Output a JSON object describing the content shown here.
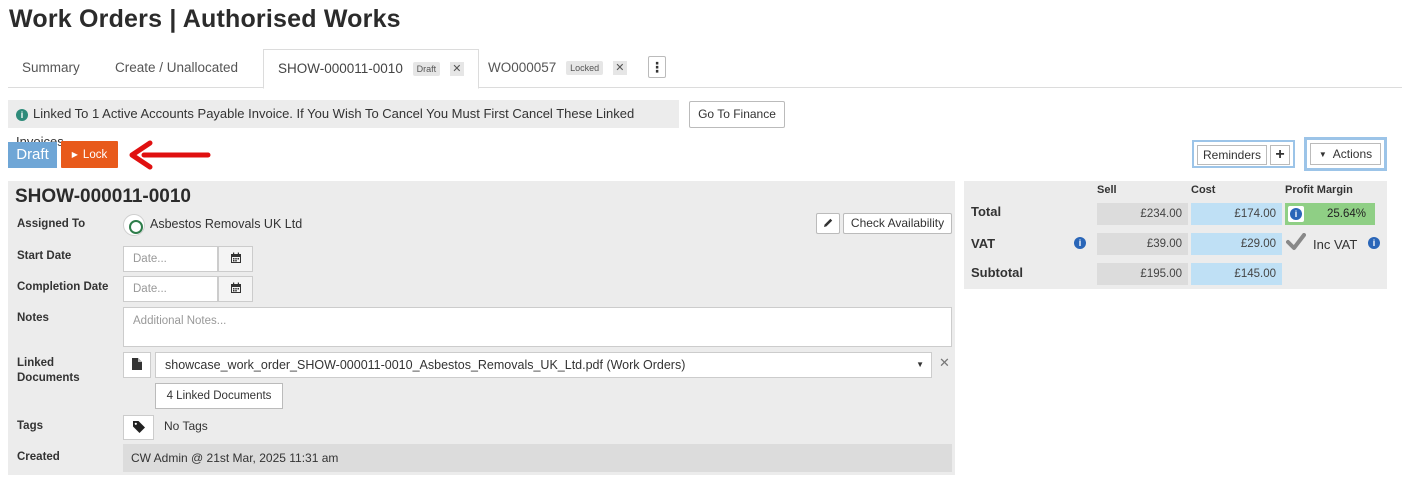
{
  "page": {
    "title": "Work Orders | Authorised Works"
  },
  "tabs": [
    {
      "label": "Summary"
    },
    {
      "label": "Create / Unallocated"
    },
    {
      "label": "SHOW-000011-0010",
      "badge": "Draft",
      "close": "✕"
    },
    {
      "label": "WO000057",
      "badge": "Locked",
      "close": "✕"
    }
  ],
  "alert": {
    "message": "Linked To 1 Active Accounts Payable Invoice. If You Wish To Cancel You Must First Cancel These Linked Invoices.",
    "button": "Go To Finance"
  },
  "status": {
    "label": "Draft",
    "lock_button": "Lock"
  },
  "toolbar": {
    "reminders": "Reminders",
    "add": "+",
    "actions": "Actions"
  },
  "work_order": {
    "id": "SHOW-000011-0010",
    "assigned_to_label": "Assigned To",
    "assigned_to": "Asbestos Removals UK Ltd",
    "check_availability": "Check Availability",
    "start_date_label": "Start Date",
    "start_date_placeholder": "Date...",
    "completion_date_label": "Completion Date",
    "completion_date_placeholder": "Date...",
    "notes_label": "Notes",
    "notes_placeholder": "Additional Notes...",
    "linked_docs_label_1": "Linked",
    "linked_docs_label_2": "Documents",
    "linked_doc_selected": "showcase_work_order_SHOW-000011-0010_Asbestos_Removals_UK_Ltd.pdf (Work Orders)",
    "linked_docs_button": "4 Linked Documents",
    "tags_label": "Tags",
    "tags_value": "No Tags",
    "created_label": "Created",
    "created_value": "CW Admin @ 21st Mar, 2025 11:31 am"
  },
  "totals": {
    "headers": {
      "sell": "Sell",
      "cost": "Cost",
      "margin": "Profit Margin"
    },
    "total": {
      "label": "Total",
      "sell": "£234.00",
      "cost": "£174.00",
      "margin": "25.64%"
    },
    "vat": {
      "label": "VAT",
      "sell": "£39.00",
      "cost": "£29.00",
      "inc_vat": "Inc VAT"
    },
    "subtotal": {
      "label": "Subtotal",
      "sell": "£195.00",
      "cost": "£145.00"
    }
  },
  "colors": {
    "draft": "#6fa6d6",
    "lock": "#e85a1b",
    "arrow": "#e01010",
    "margin": "#8fcf85",
    "cost": "#bfe0f5"
  }
}
